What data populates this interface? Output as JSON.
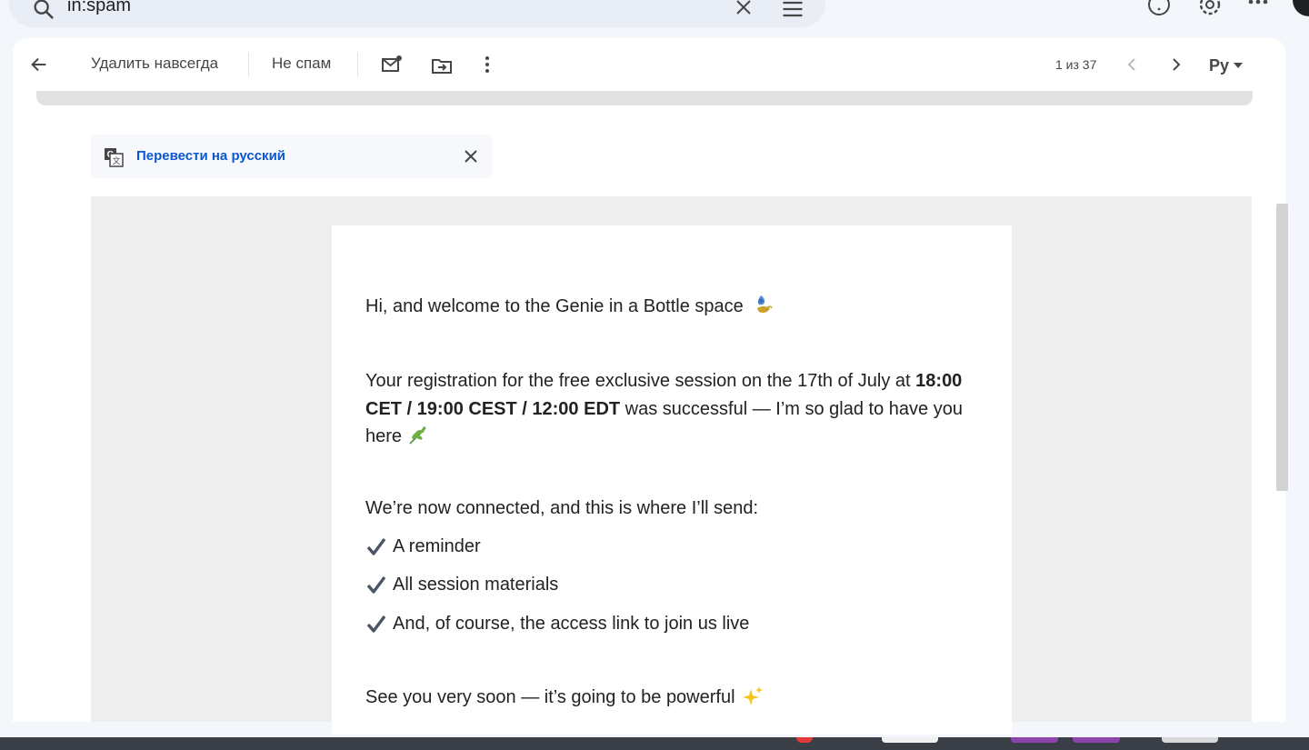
{
  "search": {
    "query": "in:spam"
  },
  "toolbar": {
    "delete_forever_label": "Удалить навсегда",
    "not_spam_label": "Не спам",
    "page_count": "1 из 37",
    "input_lang": "Ру"
  },
  "translate": {
    "link": "Перевести на русский"
  },
  "email": {
    "greeting": "Hi, and welcome to the Genie in a Bottle space",
    "reg_pre": "Your registration for the free exclusive session on the 17th of July at ",
    "reg_bold": "18:00 CET / 19:00 CEST / 12:00 EDT",
    "reg_post": " was successful — I’m so glad to have you here",
    "connected": "We’re now connected, and this is where I’ll send:",
    "items": [
      "A reminder",
      "All session materials",
      "And, of course, the access link to join us live"
    ],
    "closing": "See you very soon — it’s going to be powerful"
  },
  "colors": {
    "link": "#0b57d0",
    "check": "#4a5568"
  }
}
